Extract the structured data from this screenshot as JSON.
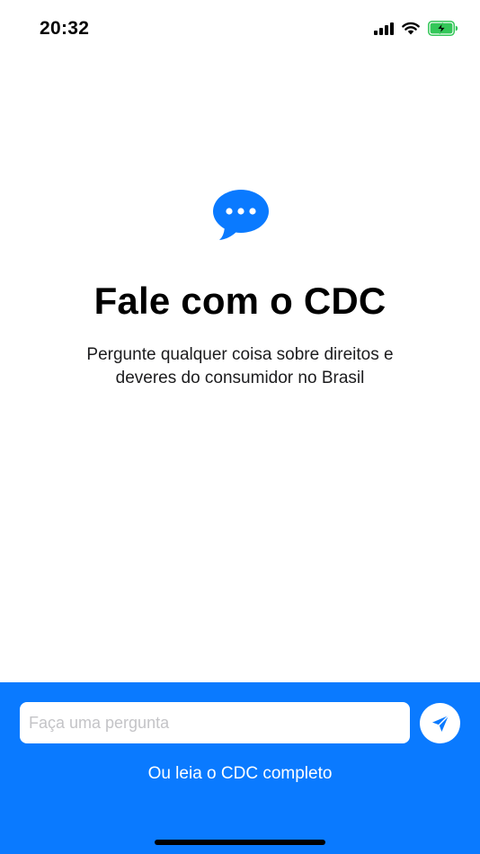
{
  "status_bar": {
    "time": "20:32",
    "icons": [
      "cellular-signal-icon",
      "wifi-icon",
      "battery-charging-icon"
    ]
  },
  "hero": {
    "icon": "chat-bubble-icon",
    "title": "Fale com o CDC",
    "subtitle": "Pergunte qualquer coisa sobre direitos e deveres do consumidor no Brasil"
  },
  "composer": {
    "input_value": "",
    "input_placeholder": "Faça uma pergunta",
    "send_icon": "send-arrow-icon",
    "read_link": "Ou leia o CDC completo"
  },
  "colors": {
    "accent": "#0A7AFF",
    "battery_green": "#34C759",
    "background": "#FFFFFF"
  }
}
